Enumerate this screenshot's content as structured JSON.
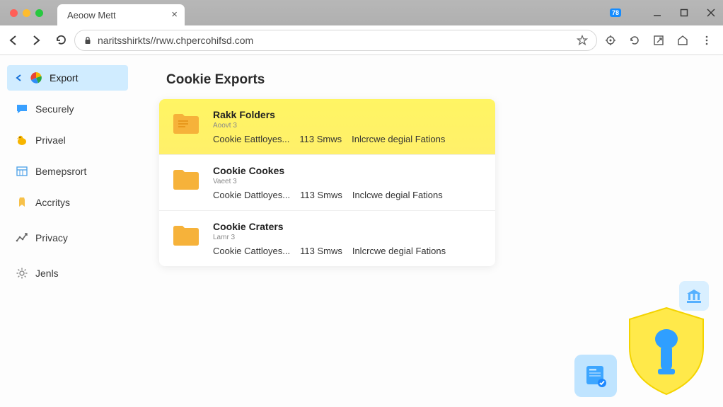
{
  "window": {
    "tab_title": "Aeoow Mett",
    "badge": "78"
  },
  "toolbar": {
    "url": "naritsshirkts//rww.chpercohifsd.com"
  },
  "sidebar": {
    "items": [
      {
        "label": "Export",
        "icon": "export-pie-icon",
        "active": true,
        "arrow": true
      },
      {
        "label": "Securely",
        "icon": "chat-icon"
      },
      {
        "label": "Privael",
        "icon": "privacy-duck-icon"
      },
      {
        "label": "Bemepsrort",
        "icon": "calendar-icon"
      },
      {
        "label": "Accritys",
        "icon": "tag-icon"
      },
      {
        "label": "Privacy",
        "icon": "chart-icon",
        "spaced": true
      },
      {
        "label": "Jenls",
        "icon": "gear-icon",
        "spaced": true
      }
    ]
  },
  "main": {
    "title": "Cookie Exports",
    "rows": [
      {
        "title": "Rakk Folders",
        "subtitle": "Aoovt 3",
        "d1": "Cookie Eattloyes...",
        "d2": "113 Smws",
        "d3": "Inlcrcwe degial Fations",
        "highlight": true
      },
      {
        "title": "Cookie Cookes",
        "subtitle": "Vaeet 3",
        "d1": "Cookie Dattloyes...",
        "d2": "113 Smws",
        "d3": "Inclcwe degial Fations",
        "highlight": false
      },
      {
        "title": "Cookie Craters",
        "subtitle": "Lamr 3",
        "d1": "Cookie Cattloyes...",
        "d2": "113 Smws",
        "d3": "Inlcrcwe degial Fations",
        "highlight": false
      }
    ]
  }
}
